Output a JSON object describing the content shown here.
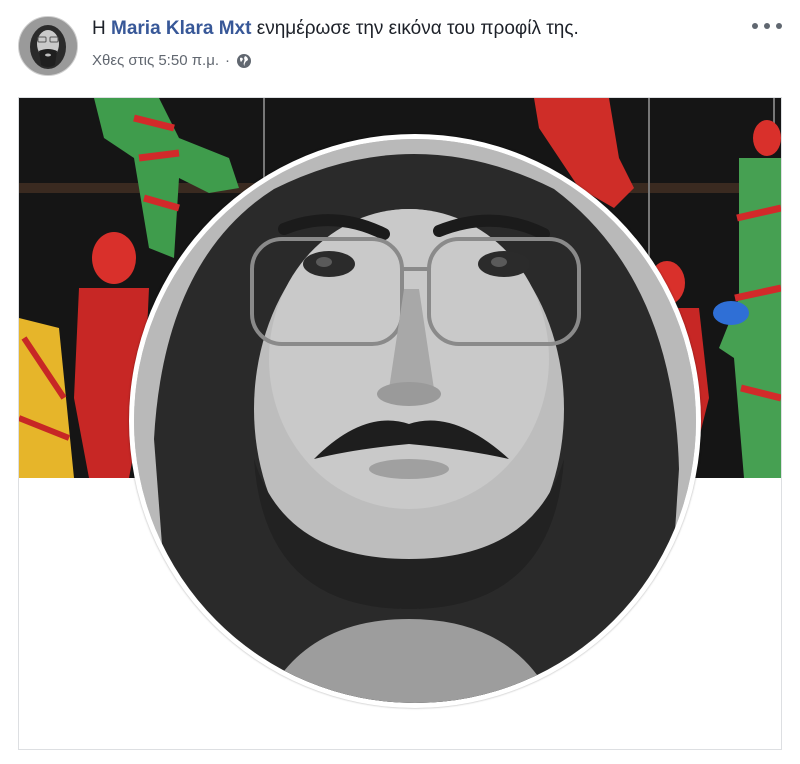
{
  "post": {
    "prefix": "Η",
    "author": "Maria Klara Mxt",
    "action": "ενημέρωσε την εικόνα του προφίλ της.",
    "timestamp": "Χθες στις 5:50 π.μ.",
    "separator": "·",
    "privacy_icon": "globe-icon",
    "menu_icon": "more-options-icon"
  },
  "colors": {
    "author_link": "#385898",
    "text": "#1d2129",
    "meta": "#616770"
  }
}
